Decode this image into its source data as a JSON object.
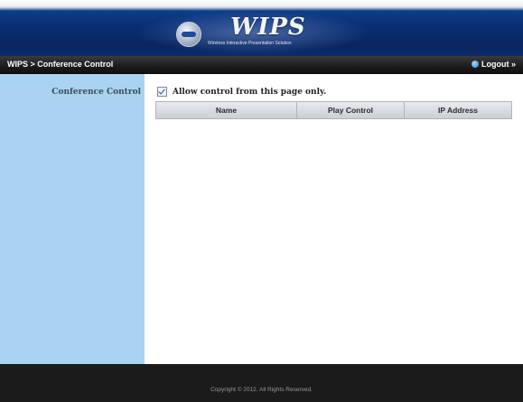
{
  "header": {
    "logo_icon": "wips-badge-icon",
    "title": "WIPS",
    "subtitle": "Wireless Interactive Presentation Solution"
  },
  "breadcrumb": {
    "path": "WIPS > Conference Control",
    "logout_label": "Logout »",
    "logout_icon": "logout-globe-icon"
  },
  "sidebar": {
    "section_label": "Conference Control"
  },
  "main": {
    "allow_control": {
      "label": "Allow control from this page only.",
      "checked": true
    },
    "table": {
      "columns": [
        "Name",
        "Play Control",
        "IP Address"
      ],
      "rows": []
    }
  },
  "footer": {
    "copyright": "Copyright © 2012. All Rights Reserved."
  },
  "colors": {
    "banner": "#0b2c6b",
    "crumbbar": "#1a1a1a",
    "sidebar": "#a9d3f1",
    "footer": "#1b1b1b"
  }
}
